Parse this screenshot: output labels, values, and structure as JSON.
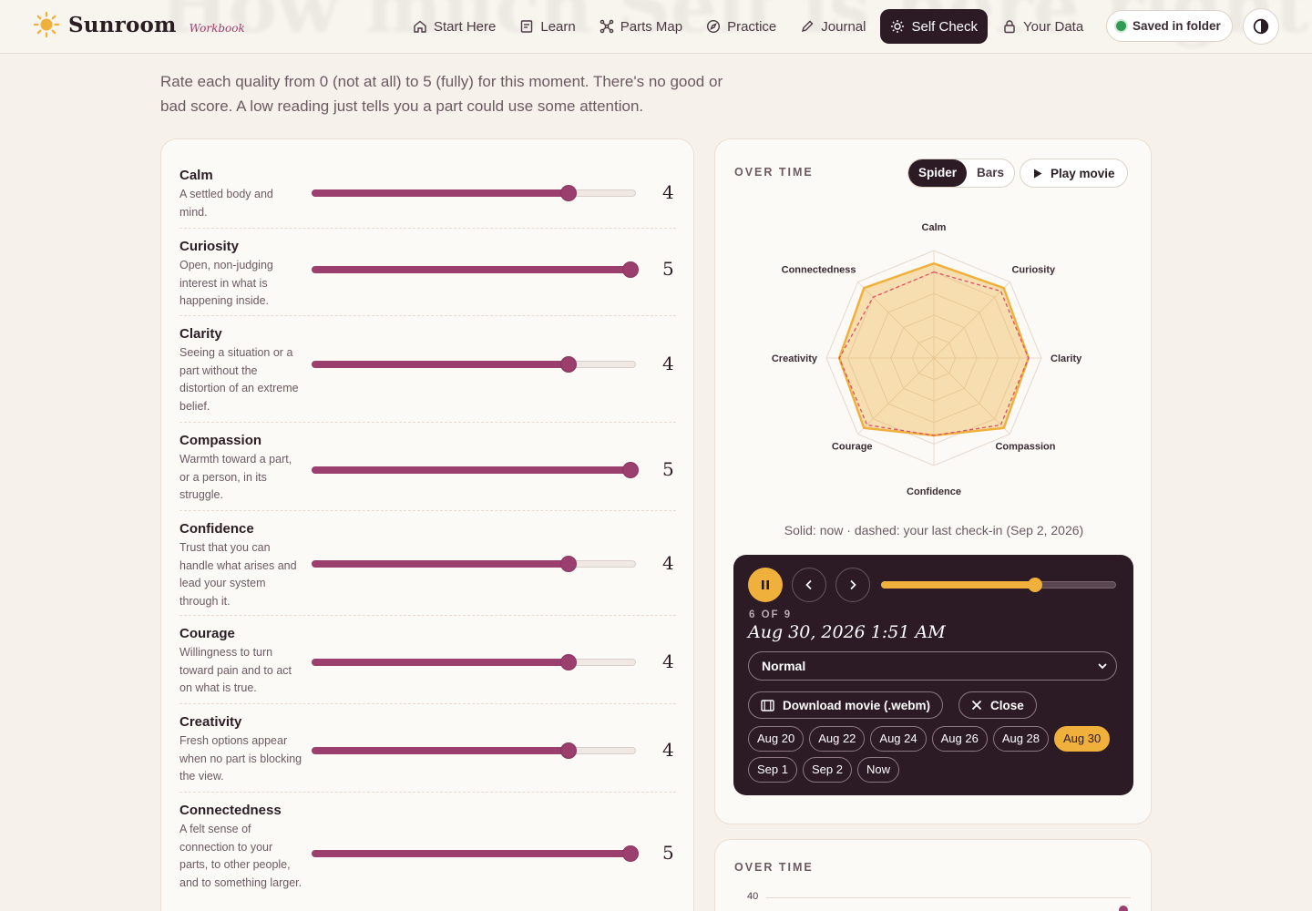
{
  "header": {
    "ghost_title": "How much Self is here right now?",
    "brand_name": "Sunroom",
    "brand_sub": "Workbook",
    "nav": [
      {
        "label": "Start Here",
        "icon": "home-icon"
      },
      {
        "label": "Learn",
        "icon": "book-icon"
      },
      {
        "label": "Parts Map",
        "icon": "network-icon"
      },
      {
        "label": "Practice",
        "icon": "compass-icon"
      },
      {
        "label": "Journal",
        "icon": "pencil-icon"
      },
      {
        "label": "Self Check",
        "icon": "sun-icon",
        "active": true
      },
      {
        "label": "Your Data",
        "icon": "lock-icon"
      }
    ],
    "saved_label": "Saved in folder",
    "theme_icon": "contrast-icon"
  },
  "intro": "Rate each quality from 0 (not at all) to 5 (fully) for this moment. There's no good or bad score. A low reading just tells you a part could use some attention.",
  "qualities": [
    {
      "name": "Calm",
      "desc": "A settled body and mind.",
      "value": 4
    },
    {
      "name": "Curiosity",
      "desc": "Open, non-judging interest in what is happening inside.",
      "value": 5
    },
    {
      "name": "Clarity",
      "desc": "Seeing a situation or a part without the distortion of an extreme belief.",
      "value": 4
    },
    {
      "name": "Compassion",
      "desc": "Warmth toward a part, or a person, in its struggle.",
      "value": 5
    },
    {
      "name": "Confidence",
      "desc": "Trust that you can handle what arises and lead your system through it.",
      "value": 4
    },
    {
      "name": "Courage",
      "desc": "Willingness to turn toward pain and to act on what is true.",
      "value": 4
    },
    {
      "name": "Creativity",
      "desc": "Fresh options appear when no part is blocking the view.",
      "value": 4
    },
    {
      "name": "Connectedness",
      "desc": "A felt sense of connection to your parts, to other people, and to something larger.",
      "value": 5
    }
  ],
  "scale_max": 5,
  "over_time": {
    "label": "OVER TIME",
    "views": [
      "Spider",
      "Bars"
    ],
    "active_view": "Spider",
    "play_label": "Play movie",
    "caption": "Solid: now · dashed: your last check-in (Sep 2, 2026)"
  },
  "chart_data": {
    "type": "radar",
    "axes": [
      "Calm",
      "Curiosity",
      "Clarity",
      "Compassion",
      "Confidence",
      "Courage",
      "Creativity",
      "Connectedness"
    ],
    "max": 5,
    "series": [
      {
        "values": [
          4.4,
          4.6,
          4.4,
          4.6,
          3.6,
          4.6,
          4.4,
          4.6
        ],
        "style": "solid",
        "color": "#f0b03c"
      },
      {
        "values": [
          4.0,
          4.4,
          4.4,
          4.4,
          3.6,
          4.4,
          4.4,
          4.0
        ],
        "style": "dashed",
        "color": "#d9506a"
      }
    ]
  },
  "player": {
    "counter": "6 OF 9",
    "date": "Aug 30, 2026 1:51 AM",
    "progress": 0.65,
    "speed": "Normal",
    "download_label": "Download movie (.webm)",
    "close_label": "Close",
    "frames": [
      "Aug 20",
      "Aug 22",
      "Aug 24",
      "Aug 26",
      "Aug 28",
      "Aug 30",
      "Sep 1",
      "Sep 2",
      "Now"
    ],
    "active_frame": "Aug 30"
  },
  "bottom_chart": {
    "label": "OVER TIME",
    "tick": "40"
  },
  "colors": {
    "accent": "#9b3f6e",
    "gold": "#f0b03c",
    "dark": "#2c1a24"
  }
}
